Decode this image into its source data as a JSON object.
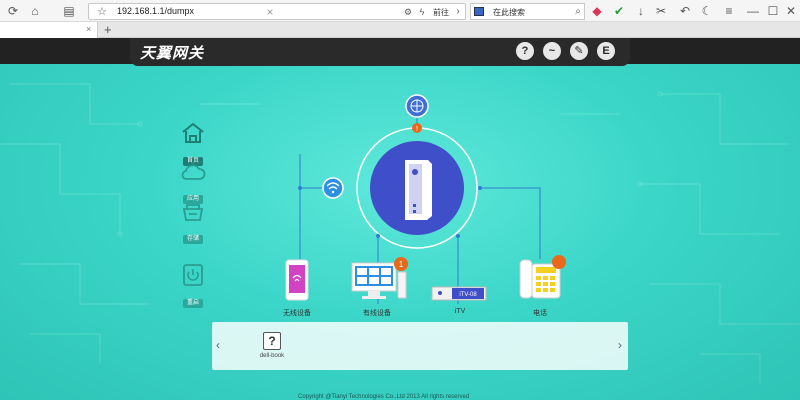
{
  "browser": {
    "url": "192.168.1.1/dumpx",
    "go_label": "前往",
    "search_placeholder": "在此搜索",
    "tab_close": "×",
    "tab_add": "+"
  },
  "app": {
    "brand": "天翼网关",
    "header_buttons": [
      "?",
      "~",
      "✎",
      "E"
    ],
    "nav": [
      "首页",
      "应用",
      "存储",
      "重启"
    ],
    "nodes": {
      "wireless": "无线设备",
      "wired": "有线设备",
      "itv": "iTV",
      "phone": "电话"
    },
    "itv_box_text": "iTV-08",
    "wired_badge": "1",
    "alert_badge": "!",
    "device": {
      "name": "dell-book",
      "icon": "?"
    },
    "copyright": "Copyright @Tianyi Technologies Co.,Ltd 2013    All rights reserved"
  },
  "colors": {
    "accent": "#3f4fc9",
    "teal": "#3bd6c8",
    "alert": "#e9691b",
    "header": "#2a2a2a"
  },
  "icons": {
    "router": "router-icon",
    "globe": "globe-icon",
    "wifi": "wifi-icon",
    "home": "home-icon",
    "cloud": "cloud-icon",
    "storage": "storage-icon",
    "power": "power-icon"
  }
}
